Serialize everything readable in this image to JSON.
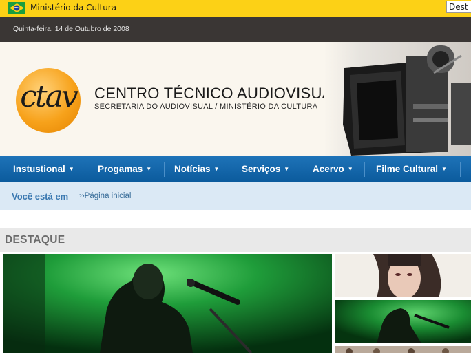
{
  "gov_bar": {
    "label": "Ministério da Cultura",
    "search_value": "Dest"
  },
  "date_bar": {
    "date": "Quinta-feira, 14 de Outubro de 2008"
  },
  "header": {
    "title": "CENTRO TÉCNICO AUDIOVISUAL",
    "subtitle": "SECRETARIA DO AUDIOVISUAL / MINISTÉRIO DA CULTURA",
    "logo_text": "ctav"
  },
  "nav": {
    "items": [
      {
        "label": "Instustional"
      },
      {
        "label": "Progamas"
      },
      {
        "label": "Notícias"
      },
      {
        "label": "Serviços"
      },
      {
        "label": "Acervo"
      },
      {
        "label": "Filme Cultural"
      }
    ]
  },
  "breadcrumb": {
    "label": "Você está em",
    "current": "››Página inicial"
  },
  "destaque": {
    "title": "DESTAQUE"
  },
  "colors": {
    "gov_yellow": "#fcd116",
    "nav_blue": "#0b5a9c",
    "crumb_bg": "#dbe9f5",
    "logo_orange": "#f7a21b"
  }
}
